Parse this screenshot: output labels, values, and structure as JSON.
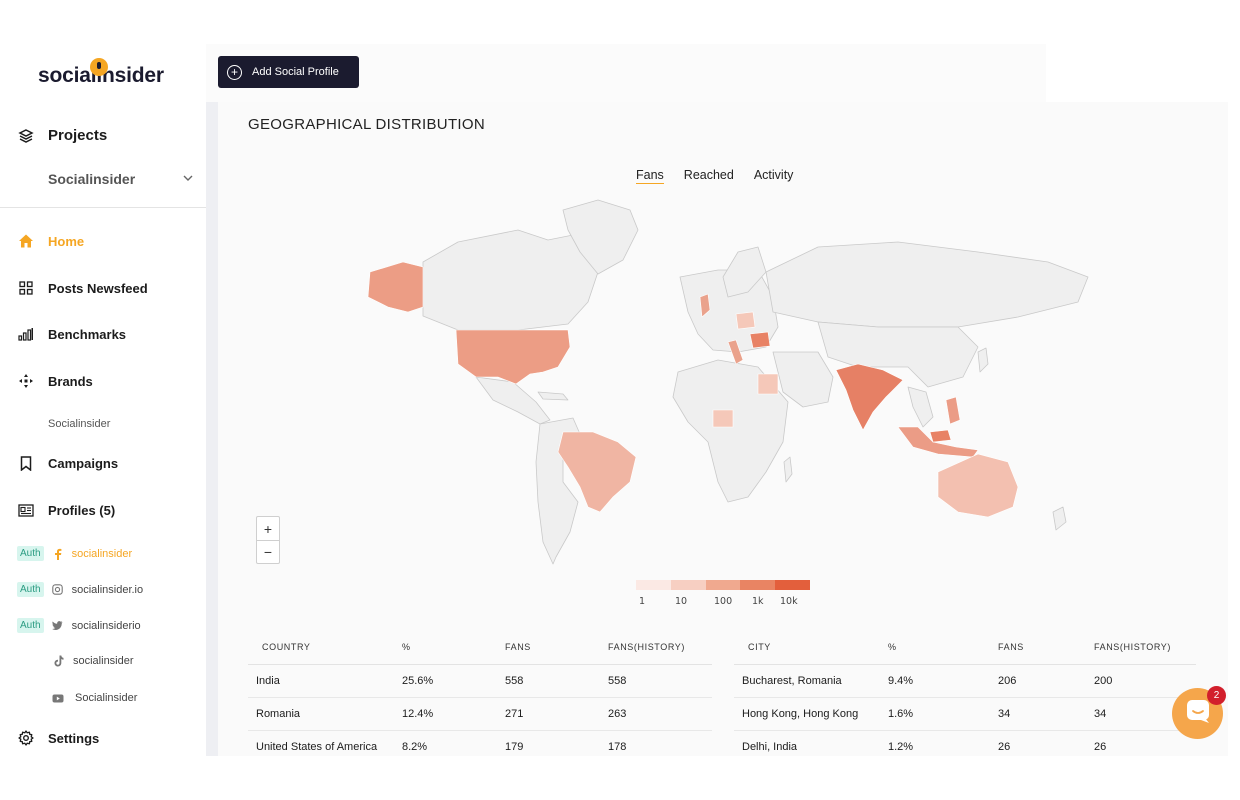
{
  "app": {
    "logo_text": "socialinsider",
    "brand_color": "#f5a623",
    "dark_color": "#1b1b2f"
  },
  "sidebar": {
    "projects_label": "Projects",
    "project_selected": "Socialinsider",
    "items": [
      {
        "label": "Home",
        "icon": "home-icon",
        "active": true
      },
      {
        "label": "Posts Newsfeed",
        "icon": "grid-icon"
      },
      {
        "label": "Benchmarks",
        "icon": "bar-chart-icon"
      },
      {
        "label": "Brands",
        "icon": "crosshair-icon"
      },
      {
        "label": "Campaigns",
        "icon": "bookmark-icon"
      },
      {
        "label": "Profiles (5)",
        "icon": "id-card-icon"
      },
      {
        "label": "Settings",
        "icon": "gear-icon"
      }
    ],
    "brand_sub": "Socialinsider",
    "profiles": [
      {
        "auth": "Auth",
        "network": "facebook-icon",
        "name": "socialinsider",
        "active": true
      },
      {
        "auth": "Auth",
        "network": "instagram-icon",
        "name": "socialinsider.io"
      },
      {
        "auth": "Auth",
        "network": "twitter-icon",
        "name": "socialinsiderio"
      },
      {
        "auth": "",
        "network": "tiktok-icon",
        "name": "socialinsider"
      },
      {
        "auth": "",
        "network": "youtube-icon",
        "name": "Socialinsider"
      }
    ]
  },
  "toolbar": {
    "add_profile_label": "Add Social Profile"
  },
  "section": {
    "title": "GEOGRAPHICAL DISTRIBUTION",
    "tabs": [
      {
        "label": "Fans",
        "active": true
      },
      {
        "label": "Reached"
      },
      {
        "label": "Activity"
      }
    ]
  },
  "map": {
    "zoom_in": "+",
    "zoom_out": "−",
    "legend_ticks": [
      "1",
      "10",
      "100",
      "1k",
      "10k"
    ],
    "legend_colors": [
      "#fbe9e4",
      "#f7cfc2",
      "#f0a98f",
      "#e98463",
      "#e35f3c"
    ]
  },
  "country_table": {
    "headers": [
      "COUNTRY",
      "%",
      "FANS",
      "FANS(HISTORY)"
    ],
    "rows": [
      [
        "India",
        "25.6%",
        "558",
        "558"
      ],
      [
        "Romania",
        "12.4%",
        "271",
        "263"
      ],
      [
        "United States of America",
        "8.2%",
        "179",
        "178"
      ]
    ]
  },
  "city_table": {
    "headers": [
      "CITY",
      "%",
      "FANS",
      "FANS(HISTORY)"
    ],
    "rows": [
      [
        "Bucharest, Romania",
        "9.4%",
        "206",
        "200"
      ],
      [
        "Hong Kong, Hong Kong",
        "1.6%",
        "34",
        "34"
      ],
      [
        "Delhi, India",
        "1.2%",
        "26",
        "26"
      ]
    ]
  },
  "chat": {
    "badge": "2"
  }
}
